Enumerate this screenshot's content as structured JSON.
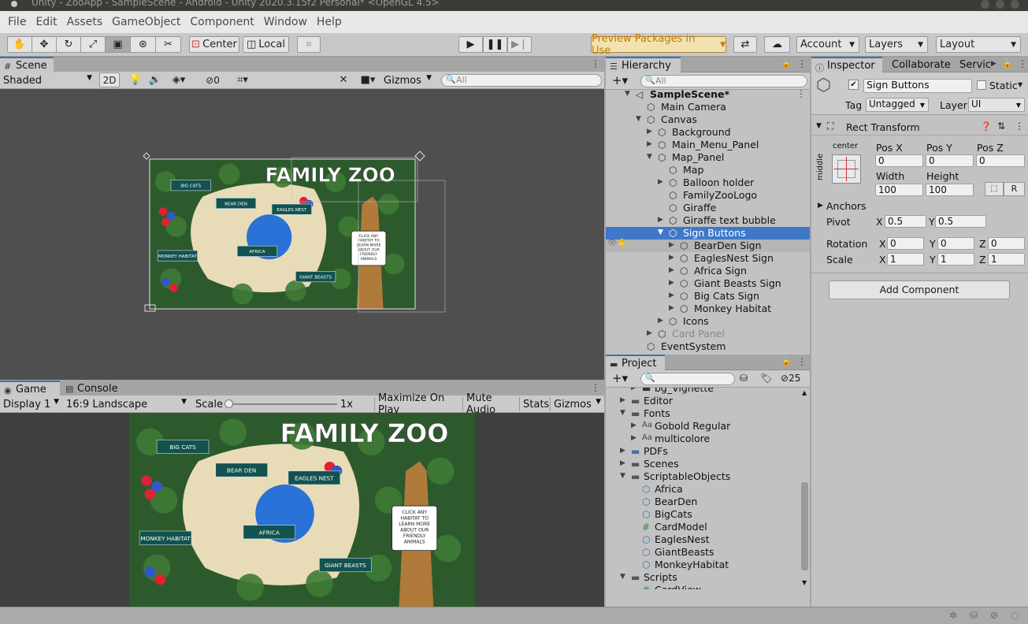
{
  "window": {
    "title": "Unity - ZooApp - SampleScene - Android - Unity 2020.3.15f2 Personal* <OpenGL 4.5>"
  },
  "menu": [
    "File",
    "Edit",
    "Assets",
    "GameObject",
    "Component",
    "Window",
    "Help"
  ],
  "toolbar": {
    "center_label": "Center",
    "local_label": "Local",
    "preview_packages": "Preview Packages in Use",
    "account": "Account",
    "layers": "Layers",
    "layout": "Layout"
  },
  "scene": {
    "tab": "Scene",
    "shading": "Shaded",
    "mode2d": "2D",
    "hidden_count": "0",
    "gizmos": "Gizmos",
    "search_placeholder": "All"
  },
  "map": {
    "title": "FAMILY ZOO",
    "signs": [
      "BIG CATS",
      "BEAR DEN",
      "EAGLES NEST",
      "AFRICA",
      "MONKEY HABITAT",
      "GIANT BEASTS"
    ],
    "bubble": "CLICK ANY HABITAT TO LEARN MORE ABOUT OUR FRIENDLY ANIMALS",
    "colors": {
      "water": "#2a72d8",
      "forest": "#2d5a2c",
      "path": "#e8dcb8",
      "sign": "#12524f"
    }
  },
  "game": {
    "tab": "Game",
    "console_tab": "Console",
    "display": "Display 1",
    "aspect": "16:9 Landscape",
    "scale_label": "Scale",
    "scale_value": "1x",
    "maximize": "Maximize On Play",
    "mute": "Mute Audio",
    "stats": "Stats",
    "gizmos": "Gizmos"
  },
  "hierarchy": {
    "tab": "Hierarchy",
    "search_placeholder": "All",
    "rows": [
      {
        "label": "SampleScene*",
        "level": 0,
        "arrow": "down",
        "icon": "unity"
      },
      {
        "label": "Main Camera",
        "level": 1,
        "arrow": "",
        "icon": "cube"
      },
      {
        "label": "Canvas",
        "level": 1,
        "arrow": "down",
        "icon": "cube"
      },
      {
        "label": "Background",
        "level": 2,
        "arrow": "right",
        "icon": "cube"
      },
      {
        "label": "Main_Menu_Panel",
        "level": 2,
        "arrow": "right",
        "icon": "cube"
      },
      {
        "label": "Map_Panel",
        "level": 2,
        "arrow": "down",
        "icon": "cube"
      },
      {
        "label": "Map",
        "level": 3,
        "arrow": "",
        "icon": "cube"
      },
      {
        "label": "Balloon holder",
        "level": 3,
        "arrow": "right",
        "icon": "cube"
      },
      {
        "label": "FamilyZooLogo",
        "level": 3,
        "arrow": "",
        "icon": "cube"
      },
      {
        "label": "Giraffe",
        "level": 3,
        "arrow": "",
        "icon": "cube"
      },
      {
        "label": "Giraffe text bubble",
        "level": 3,
        "arrow": "right",
        "icon": "cube"
      },
      {
        "label": "Sign Buttons",
        "level": 3,
        "arrow": "down",
        "icon": "cube",
        "state": "selected"
      },
      {
        "label": "BearDen Sign",
        "level": 4,
        "arrow": "right",
        "icon": "cube",
        "state": "hover"
      },
      {
        "label": "EaglesNest Sign",
        "level": 4,
        "arrow": "right",
        "icon": "cube"
      },
      {
        "label": "Africa Sign",
        "level": 4,
        "arrow": "right",
        "icon": "cube"
      },
      {
        "label": "Giant Beasts Sign",
        "level": 4,
        "arrow": "right",
        "icon": "cube"
      },
      {
        "label": "Big Cats Sign",
        "level": 4,
        "arrow": "right",
        "icon": "cube"
      },
      {
        "label": "Monkey Habitat",
        "level": 4,
        "arrow": "right",
        "icon": "cube"
      },
      {
        "label": "Icons",
        "level": 3,
        "arrow": "right",
        "icon": "cube"
      },
      {
        "label": "Card Panel",
        "level": 2,
        "arrow": "right",
        "icon": "cube",
        "state": "disabled"
      },
      {
        "label": "EventSystem",
        "level": 1,
        "arrow": "",
        "icon": "cube"
      }
    ]
  },
  "project": {
    "tab": "Project",
    "hidden_count": "25",
    "rows": [
      {
        "label": "bg_Vignette",
        "level": 1,
        "arrow": "right",
        "icon": "image"
      },
      {
        "label": "Editor",
        "level": 0,
        "arrow": "right",
        "icon": "folder"
      },
      {
        "label": "Fonts",
        "level": 0,
        "arrow": "down",
        "icon": "folder"
      },
      {
        "label": "Gobold Regular",
        "level": 1,
        "arrow": "right",
        "icon": "font"
      },
      {
        "label": "multicolore",
        "level": 1,
        "arrow": "right",
        "icon": "font"
      },
      {
        "label": "PDFs",
        "level": 0,
        "arrow": "right",
        "icon": "folder-badge"
      },
      {
        "label": "Scenes",
        "level": 0,
        "arrow": "right",
        "icon": "folder"
      },
      {
        "label": "ScriptableObjects",
        "level": 0,
        "arrow": "down",
        "icon": "folder"
      },
      {
        "label": "Africa",
        "level": 1,
        "arrow": "",
        "icon": "so"
      },
      {
        "label": "BearDen",
        "level": 1,
        "arrow": "",
        "icon": "so"
      },
      {
        "label": "BigCats",
        "level": 1,
        "arrow": "",
        "icon": "so"
      },
      {
        "label": "CardModel",
        "level": 1,
        "arrow": "",
        "icon": "script"
      },
      {
        "label": "EaglesNest",
        "level": 1,
        "arrow": "",
        "icon": "so"
      },
      {
        "label": "GiantBeasts",
        "level": 1,
        "arrow": "",
        "icon": "so"
      },
      {
        "label": "MonkeyHabitat",
        "level": 1,
        "arrow": "",
        "icon": "so"
      },
      {
        "label": "Scripts",
        "level": 0,
        "arrow": "down",
        "icon": "folder"
      },
      {
        "label": "CardView",
        "level": 1,
        "arrow": "",
        "icon": "script"
      }
    ]
  },
  "inspector": {
    "tabs": [
      "Inspector",
      "Collaborate",
      "Servic"
    ],
    "object_name": "Sign Buttons",
    "static_label": "Static",
    "tag_label": "Tag",
    "tag_value": "Untagged",
    "layer_label": "Layer",
    "layer_value": "UI",
    "component_title": "Rect Transform",
    "anchor_h": "center",
    "anchor_v": "middle",
    "pos_x_label": "Pos X",
    "pos_x": "0",
    "pos_y_label": "Pos Y",
    "pos_y": "0",
    "pos_z_label": "Pos Z",
    "pos_z": "0",
    "width_label": "Width",
    "width": "100",
    "height_label": "Height",
    "height": "100",
    "r_button": "R",
    "anchors_label": "Anchors",
    "pivot_label": "Pivot",
    "pivot_x": "0.5",
    "pivot_y": "0.5",
    "rotation_label": "Rotation",
    "rot_x": "0",
    "rot_y": "0",
    "rot_z": "0",
    "scale_label": "Scale",
    "scale_x": "1",
    "scale_y": "1",
    "scale_z": "1",
    "axis_x": "X",
    "axis_y": "Y",
    "axis_z": "Z",
    "add_component": "Add Component"
  }
}
